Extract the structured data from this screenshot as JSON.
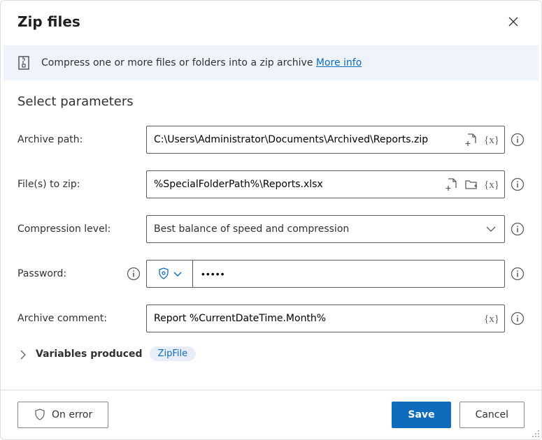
{
  "header": {
    "title": "Zip files"
  },
  "infobar": {
    "description": "Compress one or more files or folders into a zip archive ",
    "more_info": "More info"
  },
  "section_title": "Select parameters",
  "rows": {
    "archive_path": {
      "label": "Archive path:",
      "value": "C:\\Users\\Administrator\\Documents\\Archived\\Reports.zip"
    },
    "files_to_zip": {
      "label": "File(s) to zip:",
      "value": "%SpecialFolderPath%\\Reports.xlsx"
    },
    "compression": {
      "label": "Compression level:",
      "value": "Best balance of speed and compression"
    },
    "password": {
      "label": "Password:",
      "value": "•••••"
    },
    "comment": {
      "label": "Archive comment:",
      "value": "Report %CurrentDateTime.Month%"
    }
  },
  "variables": {
    "label": "Variables produced",
    "pill": "ZipFile"
  },
  "footer": {
    "on_error": "On error",
    "save": "Save",
    "cancel": "Cancel"
  }
}
